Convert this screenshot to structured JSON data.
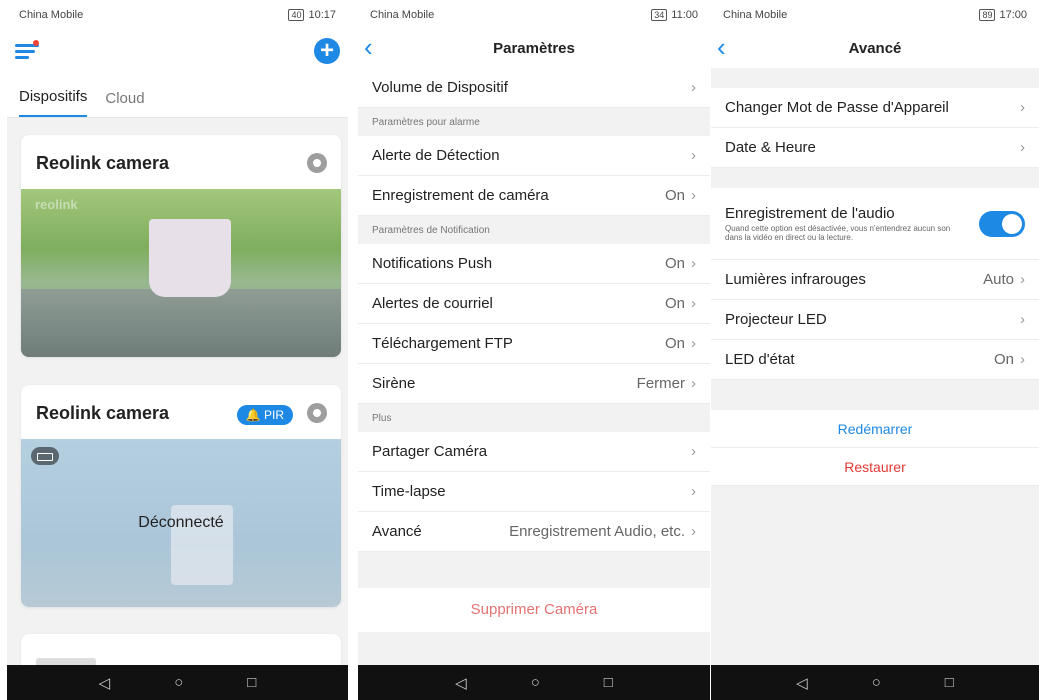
{
  "panel1": {
    "status": {
      "carrier": "China Mobile",
      "battery": "40",
      "time": "10:17"
    },
    "tabs": [
      "Dispositifs",
      "Cloud"
    ],
    "cameras": [
      {
        "name": "Reolink camera",
        "feed_watermark": "reolink"
      },
      {
        "name": "Reolink camera",
        "badge": "PIR",
        "status": "Déconnecté"
      }
    ]
  },
  "panel2": {
    "status": {
      "carrier": "China Mobile",
      "battery": "34",
      "time": "11:00"
    },
    "title": "Paramètres",
    "top_row": {
      "label": "Volume de Dispositif",
      "value": ""
    },
    "sections": [
      {
        "title": "Paramètres pour alarme",
        "rows": [
          {
            "label": "Alerte de Détection",
            "value": ""
          },
          {
            "label": "Enregistrement de caméra",
            "value": "On"
          }
        ]
      },
      {
        "title": "Paramètres de Notification",
        "rows": [
          {
            "label": "Notifications Push",
            "value": "On"
          },
          {
            "label": "Alertes de courriel",
            "value": "On"
          },
          {
            "label": "Téléchargement FTP",
            "value": "On"
          },
          {
            "label": "Sirène",
            "value": "Fermer"
          }
        ]
      },
      {
        "title": "Plus",
        "rows": [
          {
            "label": "Partager Caméra",
            "value": ""
          },
          {
            "label": "Time-lapse",
            "value": ""
          },
          {
            "label": "Avancé",
            "value": "Enregistrement Audio, etc."
          }
        ]
      }
    ],
    "delete_label": "Supprimer Caméra"
  },
  "panel3": {
    "status": {
      "carrier": "China Mobile",
      "battery": "89",
      "time": "17:00"
    },
    "title": "Avancé",
    "group1": [
      {
        "label": "Changer Mot de Passe d'Appareil",
        "value": ""
      },
      {
        "label": "Date & Heure",
        "value": ""
      }
    ],
    "audio": {
      "label": "Enregistrement de l'audio",
      "description": "Quand cette option est désactivée, vous n'entendrez aucun son dans la vidéo en direct ou la lecture.",
      "enabled": true
    },
    "group2": [
      {
        "label": "Lumières infrarouges",
        "value": "Auto"
      },
      {
        "label": "Projecteur LED",
        "value": ""
      },
      {
        "label": "LED d'état",
        "value": "On"
      }
    ],
    "reboot_label": "Redémarrer",
    "restore_label": "Restaurer"
  },
  "nav": {
    "back": "◁",
    "home": "○",
    "recent": "□"
  },
  "colors": {
    "accent": "#1e88e5",
    "danger": "#e53935"
  }
}
